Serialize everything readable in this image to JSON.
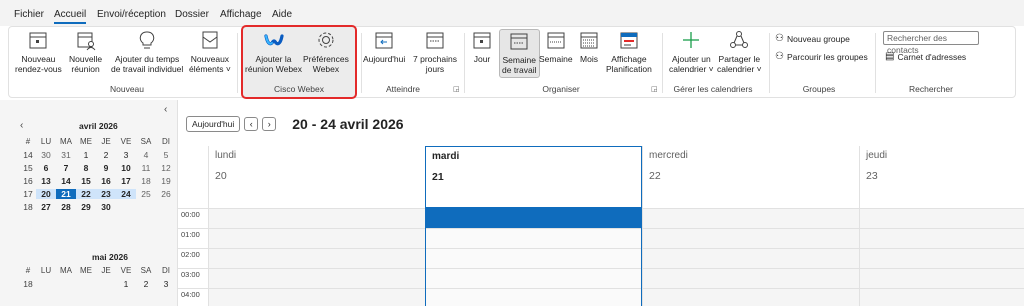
{
  "menu": {
    "tabs": [
      "Fichier",
      "Accueil",
      "Envoi/réception",
      "Dossier",
      "Affichage",
      "Aide"
    ],
    "active": "Accueil"
  },
  "ribbon": {
    "new_meeting": {
      "line1": "Nouveau",
      "line2": "rendez-vous"
    },
    "new_reunion": {
      "line1": "Nouvelle",
      "line2": "réunion"
    },
    "add_worktime": {
      "line1": "Ajouter du temps",
      "line2": "de travail individuel"
    },
    "new_items": {
      "line1": "Nouveaux",
      "line2": "éléments ˅"
    },
    "group_new": "Nouveau",
    "webex_add": {
      "line1": "Ajouter la",
      "line2": "réunion Webex"
    },
    "webex_prefs": {
      "line1": "Préférences",
      "line2": "Webex"
    },
    "group_webex": "Cisco Webex",
    "today": {
      "line1": "Aujourd'hui",
      "line2": ""
    },
    "next7": {
      "line1": "7 prochains",
      "line2": "jours"
    },
    "group_goto": "Atteindre",
    "day": "Jour",
    "workweek": {
      "line1": "Semaine",
      "line2": "de travail"
    },
    "week": "Semaine",
    "month": "Mois",
    "schedule": {
      "line1": "Affichage",
      "line2": "Planification"
    },
    "group_arrange": "Organiser",
    "add_calendar": {
      "line1": "Ajouter un",
      "line2": "calendrier ˅"
    },
    "share_calendar": {
      "line1": "Partager le",
      "line2": "calendrier ˅"
    },
    "group_manage": "Gérer les calendriers",
    "new_group": "Nouveau groupe",
    "browse_groups": "Parcourir les groupes",
    "group_groups": "Groupes",
    "search_contacts_placeholder": "Rechercher des contacts",
    "address_book": "Carnet d'adresses",
    "group_search": "Rechercher"
  },
  "mini_calendar": {
    "april": {
      "title": "avril 2026",
      "headers": [
        "#",
        "LU",
        "MA",
        "ME",
        "JE",
        "VE",
        "SA",
        "DI"
      ],
      "weeks": [
        [
          "14",
          "30",
          "31",
          "1",
          "2",
          "3",
          "4",
          "5"
        ],
        [
          "15",
          "6",
          "7",
          "8",
          "9",
          "10",
          "11",
          "12"
        ],
        [
          "16",
          "13",
          "14",
          "15",
          "16",
          "17",
          "18",
          "19"
        ],
        [
          "17",
          "20",
          "21",
          "22",
          "23",
          "24",
          "25",
          "26"
        ],
        [
          "18",
          "27",
          "28",
          "29",
          "30",
          "",
          "",
          ""
        ]
      ]
    },
    "may": {
      "title": "mai 2026",
      "headers": [
        "#",
        "LU",
        "MA",
        "ME",
        "JE",
        "VE",
        "SA",
        "DI"
      ],
      "weeks": [
        [
          "18",
          "",
          "",
          "",
          "",
          "1",
          "2",
          "3"
        ]
      ]
    }
  },
  "calendar": {
    "today_button": "Aujourd'hui",
    "range_title": "20 - 24 avril 2026",
    "days": [
      {
        "name": "lundi",
        "num": "20"
      },
      {
        "name": "mardi",
        "num": "21"
      },
      {
        "name": "mercredi",
        "num": "22"
      },
      {
        "name": "jeudi",
        "num": "23"
      }
    ],
    "times": [
      "00:00",
      "01:00",
      "02:00",
      "03:00",
      "04:00"
    ]
  }
}
